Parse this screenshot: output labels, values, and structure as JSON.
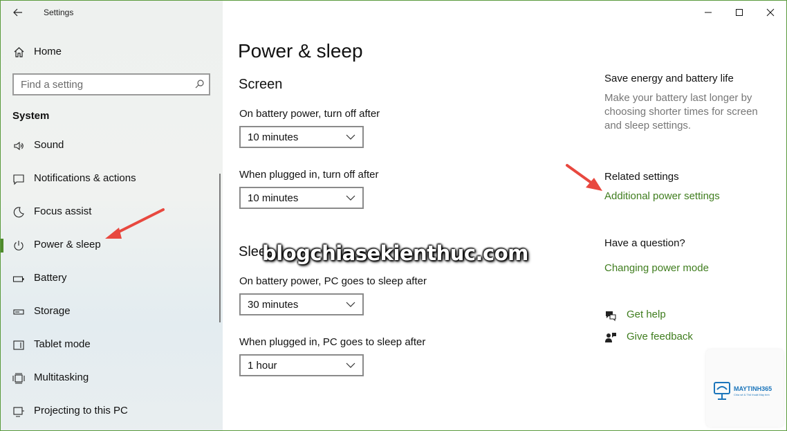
{
  "window": {
    "title": "Settings",
    "controls": {
      "minimize": "minimize-icon",
      "maximize": "maximize-icon",
      "close": "close-icon"
    }
  },
  "sidebar": {
    "home_label": "Home",
    "search_placeholder": "Find a setting",
    "section_label": "System",
    "items": [
      {
        "label": "Sound",
        "icon": "speaker-icon",
        "selected": false
      },
      {
        "label": "Notifications & actions",
        "icon": "notification-icon",
        "selected": false
      },
      {
        "label": "Focus assist",
        "icon": "moon-icon",
        "selected": false
      },
      {
        "label": "Power & sleep",
        "icon": "power-icon",
        "selected": true
      },
      {
        "label": "Battery",
        "icon": "battery-icon",
        "selected": false
      },
      {
        "label": "Storage",
        "icon": "storage-icon",
        "selected": false
      },
      {
        "label": "Tablet mode",
        "icon": "tablet-icon",
        "selected": false
      },
      {
        "label": "Multitasking",
        "icon": "multitasking-icon",
        "selected": false
      },
      {
        "label": "Projecting to this PC",
        "icon": "projector-icon",
        "selected": false
      }
    ]
  },
  "main": {
    "title": "Power & sleep",
    "screen_heading": "Screen",
    "sleep_heading": "Sleep",
    "screen_battery_label": "On battery power, turn off after",
    "screen_battery_value": "10 minutes",
    "screen_plugged_label": "When plugged in, turn off after",
    "screen_plugged_value": "10 minutes",
    "sleep_battery_label": "On battery power, PC goes to sleep after",
    "sleep_battery_value": "30 minutes",
    "sleep_plugged_label": "When plugged in, PC goes to sleep after",
    "sleep_plugged_value": "1 hour"
  },
  "right": {
    "save_heading": "Save energy and battery life",
    "save_text": "Make your battery last longer by choosing shorter times for screen and sleep settings.",
    "related_heading": "Related settings",
    "related_link": "Additional power settings",
    "question_heading": "Have a question?",
    "question_link": "Changing power mode",
    "get_help": "Get help",
    "give_feedback": "Give feedback"
  },
  "overlay": {
    "watermark": "blogchiasekienthuc.com",
    "logo_text": "MAYTINH365",
    "logo_sub": "Chia sẻ & Thủ thuật Máy tính"
  },
  "colors": {
    "accent": "#4e8a2c",
    "link": "#3f7d1e",
    "annotation_arrow": "#e8483f"
  }
}
